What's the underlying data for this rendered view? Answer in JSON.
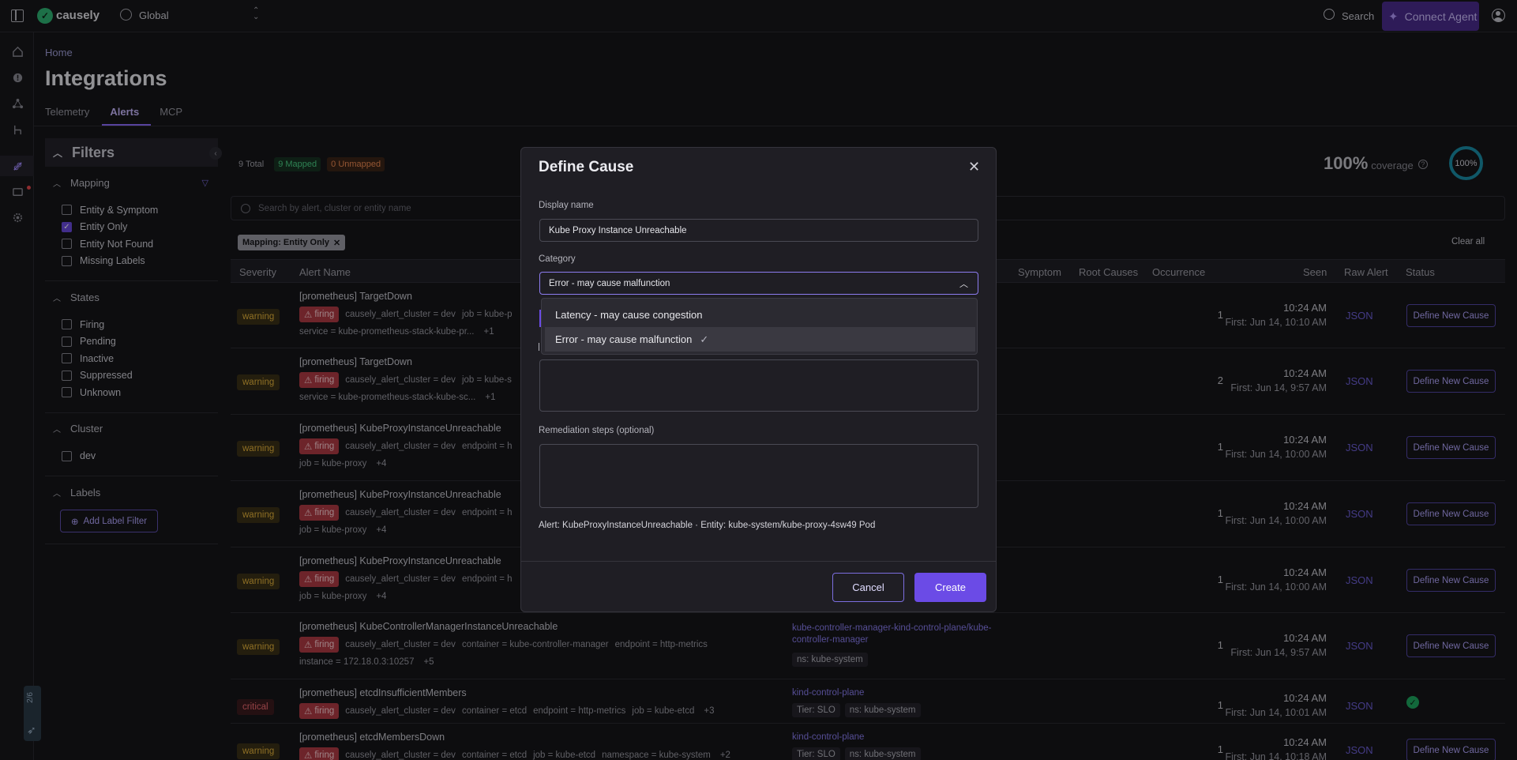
{
  "topbar": {
    "brand": "causely",
    "scope": "Global",
    "search_label": "Search",
    "connect_label": "Connect Agent"
  },
  "rail": {
    "icons": [
      "home-icon",
      "alert-icon",
      "topology-icon",
      "flow-icon",
      "integrations-icon",
      "chat-icon",
      "settings-icon"
    ],
    "widget_label": "2/6"
  },
  "page": {
    "breadcrumb": "Home",
    "title": "Integrations",
    "tabs": [
      "Telemetry",
      "Alerts",
      "MCP"
    ],
    "active_tab": "Alerts"
  },
  "filters": {
    "title": "Filters",
    "sections": [
      {
        "title": "Mapping",
        "items": [
          {
            "label": "Entity & Symptom",
            "checked": false
          },
          {
            "label": "Entity Only",
            "checked": true
          },
          {
            "label": "Entity Not Found",
            "checked": false
          },
          {
            "label": "Missing Labels",
            "checked": false
          }
        ]
      },
      {
        "title": "States",
        "items": [
          {
            "label": "Firing",
            "checked": false
          },
          {
            "label": "Pending",
            "checked": false
          },
          {
            "label": "Inactive",
            "checked": false
          },
          {
            "label": "Suppressed",
            "checked": false
          },
          {
            "label": "Unknown",
            "checked": false
          }
        ]
      },
      {
        "title": "Cluster",
        "items": [
          {
            "label": "dev",
            "checked": false
          }
        ]
      },
      {
        "title": "Labels",
        "items": []
      }
    ],
    "add_label_filter": "Add Label Filter"
  },
  "summary": {
    "total": "9 Total",
    "mapped": "9 Mapped",
    "unmapped": "0 Unmapped",
    "coverage_value": "100%",
    "coverage_label": "coverage",
    "ring_value": "100%"
  },
  "search": {
    "placeholder": "Search by alert, cluster or entity name"
  },
  "active_filter_chip": "Mapping: Entity Only",
  "clear_all": "Clear all",
  "table": {
    "headers": {
      "severity": "Severity",
      "alert_name": "Alert Name",
      "symptom": "Symptom",
      "root_causes": "Root Causes",
      "occurrence": "Occurrence",
      "seen": "Seen",
      "raw_alert": "Raw Alert",
      "status": "Status"
    },
    "rows": [
      {
        "severity": "warning",
        "name": "[prometheus] TargetDown",
        "state": "firing",
        "tags": [
          "causely_alert_cluster = dev",
          "job = kube-p"
        ],
        "tags2": [
          "service = kube-prometheus-stack-kube-pr...",
          "+1"
        ],
        "occurrence": "1",
        "seen": "10:24 AM",
        "first": "First: Jun 14, 10:10 AM",
        "raw": "JSON",
        "status": "Define New Cause"
      },
      {
        "severity": "warning",
        "name": "[prometheus] TargetDown",
        "state": "firing",
        "tags": [
          "causely_alert_cluster = dev",
          "job = kube-s"
        ],
        "tags2": [
          "service = kube-prometheus-stack-kube-sc...",
          "+1"
        ],
        "occurrence": "2",
        "seen": "10:24 AM",
        "first": "First: Jun 14, 9:57 AM",
        "raw": "JSON",
        "status": "Define New Cause"
      },
      {
        "severity": "warning",
        "name": "[prometheus] KubeProxyInstanceUnreachable",
        "state": "firing",
        "tags": [
          "causely_alert_cluster = dev",
          "endpoint = h"
        ],
        "tags2": [
          "job = kube-proxy",
          "+4"
        ],
        "occurrence": "1",
        "seen": "10:24 AM",
        "first": "First: Jun 14, 10:00 AM",
        "raw": "JSON",
        "status": "Define New Cause"
      },
      {
        "severity": "warning",
        "name": "[prometheus] KubeProxyInstanceUnreachable",
        "state": "firing",
        "tags": [
          "causely_alert_cluster = dev",
          "endpoint = h"
        ],
        "tags2": [
          "job = kube-proxy",
          "+4"
        ],
        "occurrence": "1",
        "seen": "10:24 AM",
        "first": "First: Jun 14, 10:00 AM",
        "raw": "JSON",
        "status": "Define New Cause"
      },
      {
        "severity": "warning",
        "name": "[prometheus] KubeProxyInstanceUnreachable",
        "state": "firing",
        "tags": [
          "causely_alert_cluster = dev",
          "endpoint = h"
        ],
        "tags2": [
          "job = kube-proxy",
          "+4"
        ],
        "occurrence": "1",
        "seen": "10:24 AM",
        "first": "First: Jun 14, 10:00 AM",
        "raw": "JSON",
        "status": "Define New Cause"
      },
      {
        "severity": "warning",
        "name": "[prometheus] KubeControllerManagerInstanceUnreachable",
        "state": "firing",
        "tags": [
          "causely_alert_cluster = dev",
          "container = kube-controller-manager",
          "endpoint = http-metrics"
        ],
        "tags2": [
          "instance = 172.18.0.3:10257",
          "+5"
        ],
        "entity": "kube-controller-manager-kind-control-plane/kube-controller-manager",
        "entity_tags": [
          "ns: kube-system"
        ],
        "occurrence": "1",
        "seen": "10:24 AM",
        "first": "First: Jun 14, 9:57 AM",
        "raw": "JSON",
        "status": "Define New Cause"
      },
      {
        "severity": "critical",
        "name": "[prometheus] etcdInsufficientMembers",
        "state": "firing",
        "tags": [
          "causely_alert_cluster = dev",
          "container = etcd",
          "endpoint = http-metrics",
          "job = kube-etcd",
          "+3"
        ],
        "tags2": [],
        "entity": "kind-control-plane",
        "entity_tags": [
          "Tier: SLO",
          "ns: kube-system"
        ],
        "occurrence": "1",
        "seen": "10:24 AM",
        "first": "First: Jun 14, 10:01 AM",
        "raw": "JSON",
        "status": "ok"
      },
      {
        "severity": "warning",
        "name": "[prometheus] etcdMembersDown",
        "state": "firing",
        "tags": [
          "causely_alert_cluster = dev",
          "container = etcd",
          "job = kube-etcd",
          "namespace = kube-system",
          "+2"
        ],
        "tags2": [],
        "entity": "kind-control-plane",
        "entity_tags": [
          "Tier: SLO",
          "ns: kube-system"
        ],
        "occurrence": "1",
        "seen": "10:24 AM",
        "first": "First: Jun 14, 10:18 AM",
        "raw": "JSON",
        "status": "Define New Cause"
      }
    ]
  },
  "modal": {
    "title": "Define Cause",
    "display_name_label": "Display name",
    "display_name_value": "Kube Proxy Instance Unreachable",
    "category_label": "Category",
    "category_value": "Error - may cause malfunction",
    "options": [
      "Latency - may cause congestion",
      "Error - may cause malfunction"
    ],
    "remediation_label": "Remediation steps (optional)",
    "note": "Alert: KubeProxyInstanceUnreachable · Entity: kube-system/kube-proxy-4sw49 Pod",
    "cancel": "Cancel",
    "create": "Create"
  },
  "colors": {
    "accent": "#6b4be6",
    "warning": "#e7b43b",
    "critical": "#f26b72",
    "firing": "#b03a44",
    "ok": "#1ea860"
  }
}
